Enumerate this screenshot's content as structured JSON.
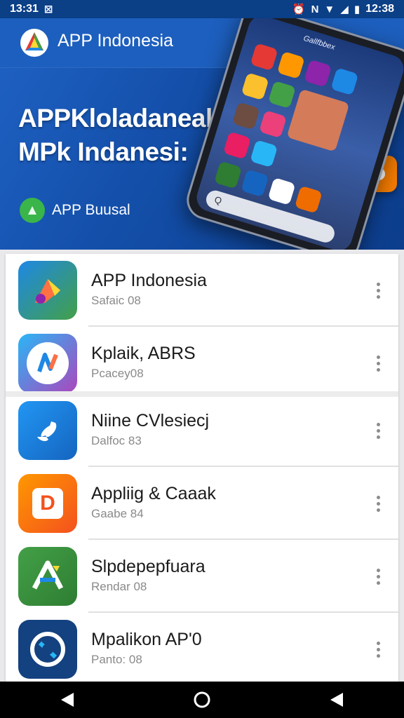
{
  "status_bar": {
    "time": "13:31",
    "notification_icon": "square-x-icon",
    "clock_right": "12:38"
  },
  "banner": {
    "brand_title": "APP Indonesia",
    "hero_line1": "APPKloladaneal",
    "hero_line2": "MPk Indanesi:",
    "badge_text": "APP Buusal",
    "phone_label": "Gallfbbex",
    "phone_search_hint": "Q"
  },
  "apps": [
    {
      "name": "APP Indonesia",
      "sub": "Safaic 08",
      "icon": "pen-gradient-icon"
    },
    {
      "name": "Kplaik, ABRS",
      "sub": "Pcacey08",
      "icon": "n-logo-icon"
    },
    {
      "name": "Niine CVlesiecj",
      "sub": "Dalfoc 83",
      "icon": "phone-handset-icon"
    },
    {
      "name": "Appliig & Caaak",
      "sub": "Gaabe 84",
      "icon": "orange-d-icon"
    },
    {
      "name": "Slpdepepfuara",
      "sub": "Rendar 08",
      "icon": "green-a-icon"
    },
    {
      "name": "Mpalikon AP'0",
      "sub": "Panto: 08",
      "icon": "blue-circle-icon"
    }
  ],
  "colors": {
    "banner": "#134ea8",
    "status_bar": "#0b3f86",
    "nav_bar": "#000000"
  }
}
